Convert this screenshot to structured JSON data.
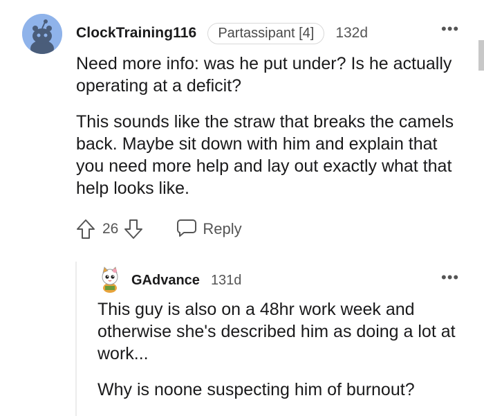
{
  "comment": {
    "username": "ClockTraining116",
    "flair": "Partassipant [4]",
    "age": "132d",
    "more_label": "•••",
    "paragraphs": [
      "Need more info: was he put under? Is he actually operating at a deficit?",
      "This sounds like the straw that breaks the camels back. Maybe sit down with him and explain that you need more help and lay out exactly what that help looks like."
    ],
    "score": "26",
    "reply_label": "Reply",
    "avatar_color": "#8fb3ea"
  },
  "reply": {
    "username": "GAdvance",
    "age": "131d",
    "more_label": "•••",
    "paragraphs": [
      "This guy is also on a 48hr work week and otherwise she's described him as doing a lot at work...",
      "Why is noone suspecting him of burnout?"
    ]
  },
  "icons": {
    "upvote": "arrow-up-outline-icon",
    "downvote": "arrow-down-outline-icon",
    "reply": "speech-bubble-icon",
    "more": "ellipsis-icon"
  }
}
